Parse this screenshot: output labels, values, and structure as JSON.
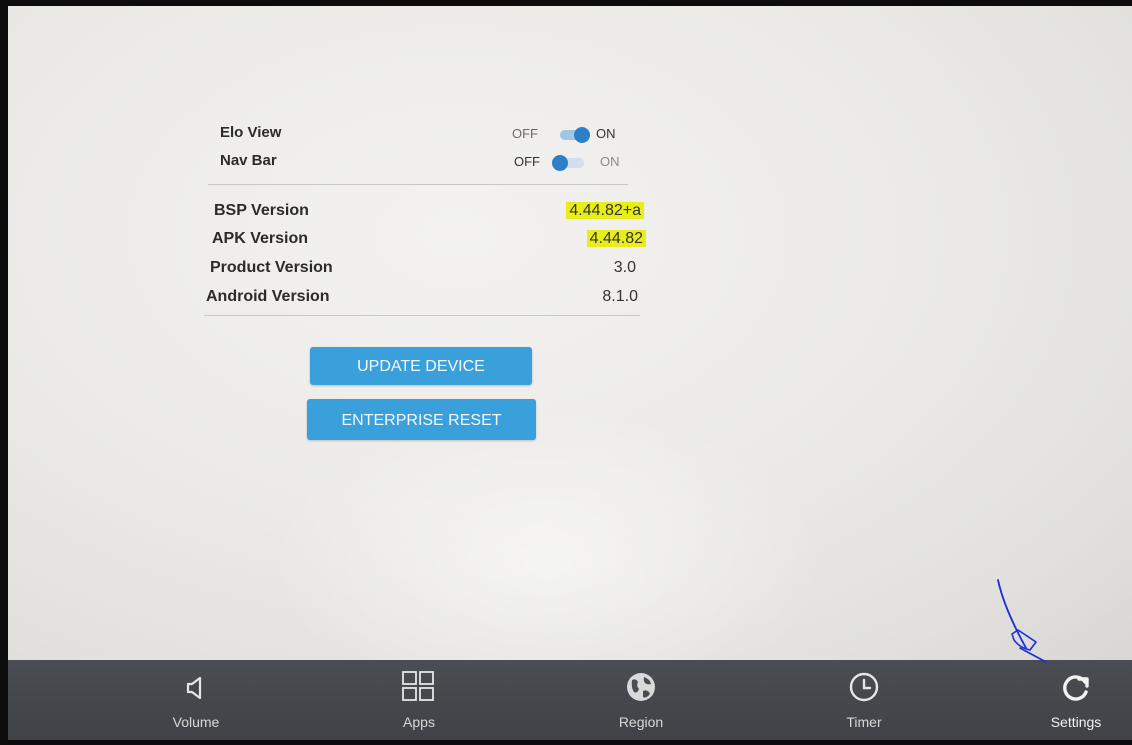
{
  "toggles": [
    {
      "label": "Elo View",
      "off_label": "OFF",
      "on_label": "ON",
      "state": "on"
    },
    {
      "label": "Nav Bar",
      "off_label": "OFF",
      "on_label": "ON",
      "state": "off"
    }
  ],
  "info": [
    {
      "label": "BSP Version",
      "value": "4.44.82+a",
      "highlighted": true
    },
    {
      "label": "APK Version",
      "value": "4.44.82",
      "highlighted": true
    },
    {
      "label": "Product Version",
      "value": "3.0",
      "highlighted": false
    },
    {
      "label": "Android Version",
      "value": "8.1.0",
      "highlighted": false
    }
  ],
  "actions": {
    "update_label": "UPDATE DEVICE",
    "reset_label": "ENTERPRISE RESET"
  },
  "navbar": {
    "items": [
      {
        "label": "Volume",
        "icon": "volume-icon"
      },
      {
        "label": "Apps",
        "icon": "apps-grid-icon"
      },
      {
        "label": "Region",
        "icon": "globe-icon"
      },
      {
        "label": "Timer",
        "icon": "clock-icon"
      },
      {
        "label": "Settings",
        "icon": "refresh-icon"
      }
    ]
  },
  "colors": {
    "accent": "#3aa0db",
    "toggle_knob": "#2d7fc6",
    "highlight": "#e9ee1a",
    "navbar": "#45484d"
  }
}
